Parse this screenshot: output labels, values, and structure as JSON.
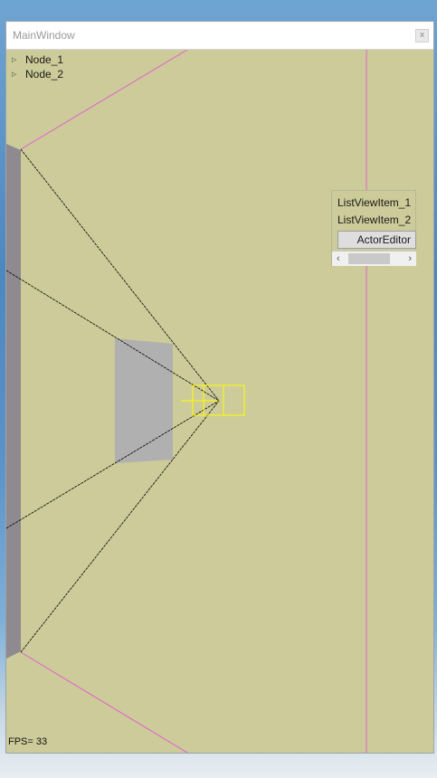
{
  "window": {
    "title": "MainWindow",
    "close_label": "x"
  },
  "tree": {
    "items": [
      {
        "label": "Node_1"
      },
      {
        "label": "Node_2"
      }
    ]
  },
  "listview": {
    "items": [
      {
        "label": "ListViewItem_1"
      },
      {
        "label": "ListViewItem_2"
      }
    ],
    "button_label": "ActorEditor",
    "scroll_left": "‹",
    "scroll_right": "›"
  },
  "status": {
    "fps": "FPS= 33"
  },
  "colors": {
    "viewport_bg": "#cccb99",
    "frustum_line": "#e060d0",
    "ray_line": "#000000",
    "gizmo": "#ffff00",
    "quad": "#b0b0b0",
    "wall": "#8e8a90"
  }
}
